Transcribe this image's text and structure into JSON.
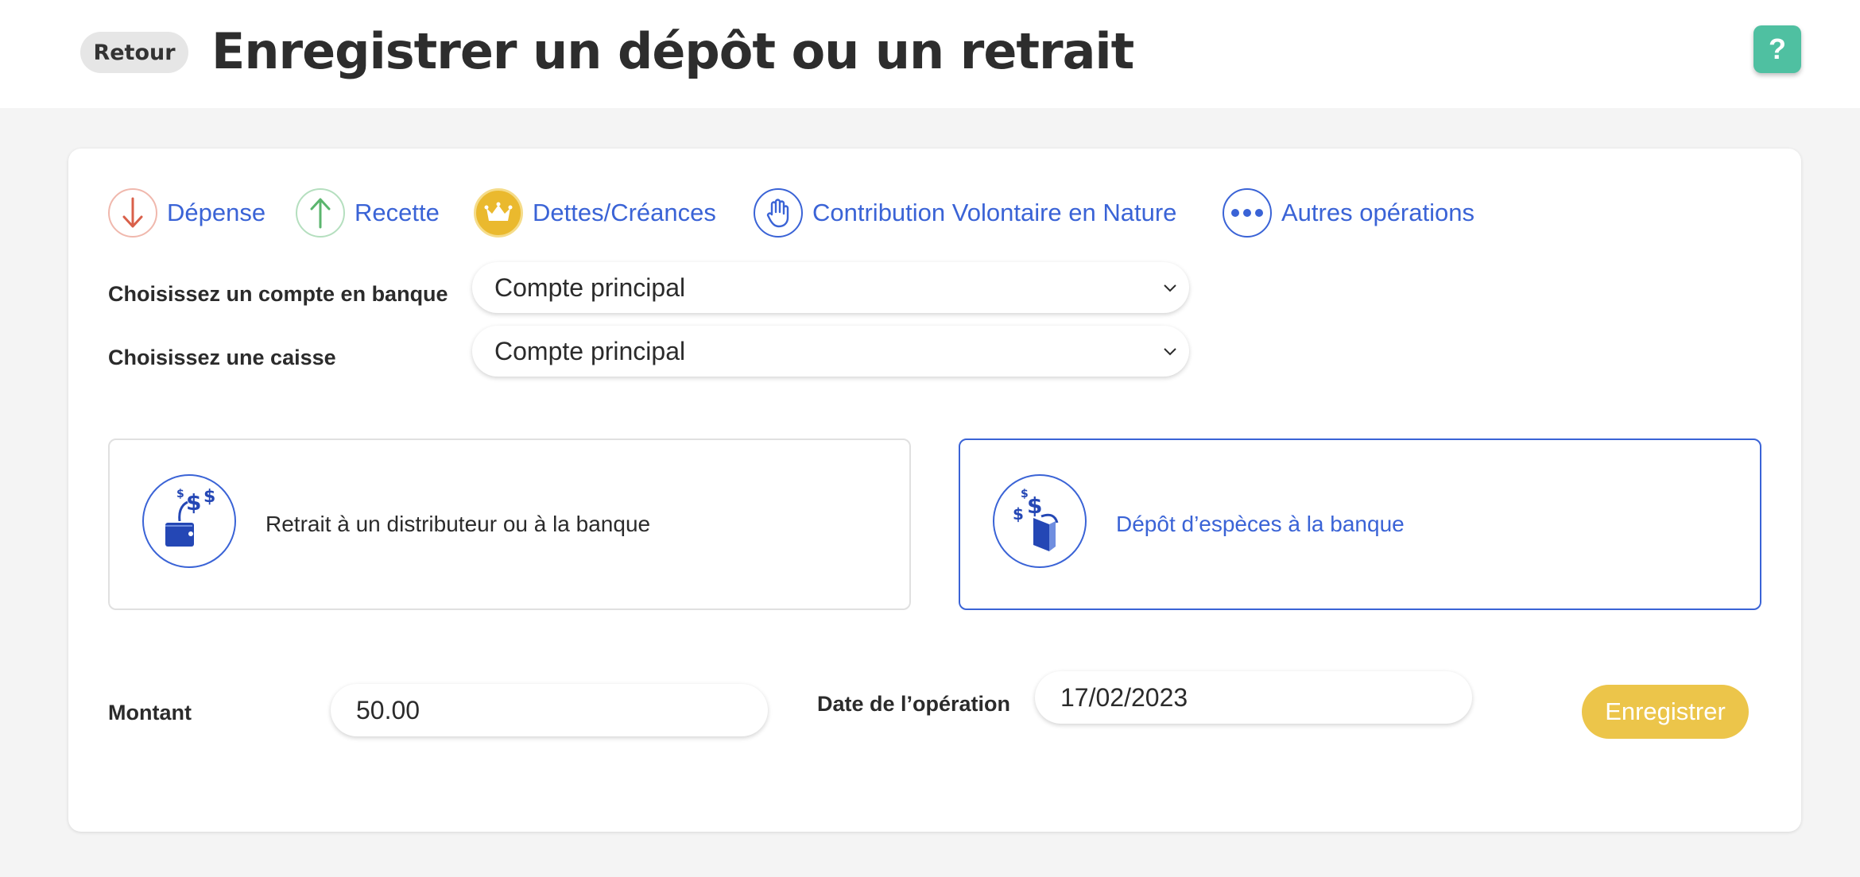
{
  "header": {
    "back_label": "Retour",
    "title": "Enregistrer un dépôt ou un retrait",
    "help_label": "?"
  },
  "operation_tabs": [
    {
      "label": "Dépense",
      "icon": "arrow-down-icon",
      "color": "#d9604a"
    },
    {
      "label": "Recette",
      "icon": "arrow-up-icon",
      "color": "#5bb56e"
    },
    {
      "label": "Dettes/Créances",
      "icon": "crown-icon",
      "color": "#eab92e"
    },
    {
      "label": "Contribution Volontaire en Nature",
      "icon": "hand-icon",
      "color": "#3a63d6"
    },
    {
      "label": "Autres opérations",
      "icon": "more-dots-icon",
      "color": "#3a63d6"
    }
  ],
  "form": {
    "bank_account_label": "Choisissez un compte en banque",
    "bank_account_value": "Compte principal",
    "cash_box_label": "Choisissez une caisse",
    "cash_box_value": "Compte principal"
  },
  "choices": [
    {
      "label": "Retrait à un distributeur ou à la banque",
      "icon": "cash-withdrawal-icon",
      "selected": false
    },
    {
      "label": "Dépôt d’espèces à la banque",
      "icon": "cash-deposit-icon",
      "selected": true
    }
  ],
  "amount": {
    "label": "Montant",
    "value": "50.00"
  },
  "date": {
    "label": "Date de l’opération",
    "value": "17/02/2023"
  },
  "save_label": "Enregistrer",
  "colors": {
    "accent_blue": "#3a63d6",
    "save_yellow": "#ecc54a",
    "help_green": "#4fc0a1"
  }
}
